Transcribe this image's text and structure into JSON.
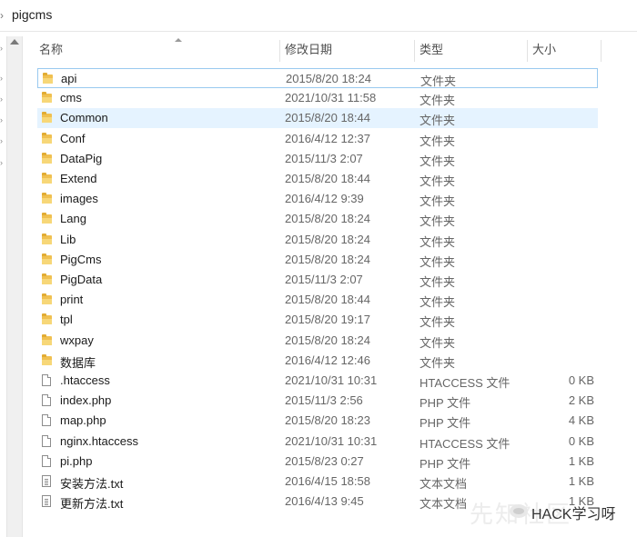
{
  "breadcrumb": {
    "current": "pigcms"
  },
  "columns": {
    "name": "名称",
    "date": "修改日期",
    "type": "类型",
    "size": "大小"
  },
  "files": [
    {
      "name": "api",
      "date": "2015/8/20 18:24",
      "type": "文件夹",
      "size": "",
      "icon": "folder-icon"
    },
    {
      "name": "cms",
      "date": "2021/10/31 11:58",
      "type": "文件夹",
      "size": "",
      "icon": "folder-icon"
    },
    {
      "name": "Common",
      "date": "2015/8/20 18:44",
      "type": "文件夹",
      "size": "",
      "icon": "folder-icon"
    },
    {
      "name": "Conf",
      "date": "2016/4/12 12:37",
      "type": "文件夹",
      "size": "",
      "icon": "folder-icon"
    },
    {
      "name": "DataPig",
      "date": "2015/11/3 2:07",
      "type": "文件夹",
      "size": "",
      "icon": "folder-icon"
    },
    {
      "name": "Extend",
      "date": "2015/8/20 18:44",
      "type": "文件夹",
      "size": "",
      "icon": "folder-icon"
    },
    {
      "name": "images",
      "date": "2016/4/12 9:39",
      "type": "文件夹",
      "size": "",
      "icon": "folder-icon"
    },
    {
      "name": "Lang",
      "date": "2015/8/20 18:24",
      "type": "文件夹",
      "size": "",
      "icon": "folder-icon"
    },
    {
      "name": "Lib",
      "date": "2015/8/20 18:24",
      "type": "文件夹",
      "size": "",
      "icon": "folder-icon"
    },
    {
      "name": "PigCms",
      "date": "2015/8/20 18:24",
      "type": "文件夹",
      "size": "",
      "icon": "folder-icon"
    },
    {
      "name": "PigData",
      "date": "2015/11/3 2:07",
      "type": "文件夹",
      "size": "",
      "icon": "folder-icon"
    },
    {
      "name": "print",
      "date": "2015/8/20 18:44",
      "type": "文件夹",
      "size": "",
      "icon": "folder-icon"
    },
    {
      "name": "tpl",
      "date": "2015/8/20 19:17",
      "type": "文件夹",
      "size": "",
      "icon": "folder-icon"
    },
    {
      "name": "wxpay",
      "date": "2015/8/20 18:24",
      "type": "文件夹",
      "size": "",
      "icon": "folder-icon"
    },
    {
      "name": "数据库",
      "date": "2016/4/12 12:46",
      "type": "文件夹",
      "size": "",
      "icon": "folder-icon"
    },
    {
      "name": ".htaccess",
      "date": "2021/10/31 10:31",
      "type": "HTACCESS 文件",
      "size": "0 KB",
      "icon": "file-icon"
    },
    {
      "name": "index.php",
      "date": "2015/11/3 2:56",
      "type": "PHP 文件",
      "size": "2 KB",
      "icon": "file-icon"
    },
    {
      "name": "map.php",
      "date": "2015/8/20 18:23",
      "type": "PHP 文件",
      "size": "4 KB",
      "icon": "file-icon"
    },
    {
      "name": "nginx.htaccess",
      "date": "2021/10/31 10:31",
      "type": "HTACCESS 文件",
      "size": "0 KB",
      "icon": "file-icon"
    },
    {
      "name": "pi.php",
      "date": "2015/8/23 0:27",
      "type": "PHP 文件",
      "size": "1 KB",
      "icon": "file-icon"
    },
    {
      "name": "安装方法.txt",
      "date": "2016/4/15 18:58",
      "type": "文本文档",
      "size": "1 KB",
      "icon": "text-file-icon"
    },
    {
      "name": "更新方法.txt",
      "date": "2016/4/13 9:45",
      "type": "文本文档",
      "size": "1 KB",
      "icon": "text-file-icon"
    }
  ],
  "watermark": {
    "text": "HACK学习呀",
    "ghost": "先知社区"
  },
  "colors": {
    "selection": "#e5f3ff",
    "focus_border": "#99c9ef",
    "folder": "#f0c050"
  }
}
